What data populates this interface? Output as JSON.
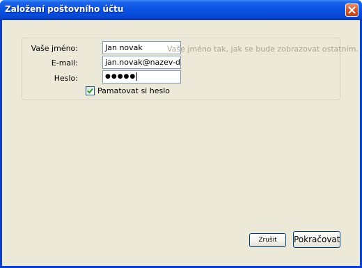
{
  "window": {
    "title": "Založení poštovního účtu"
  },
  "form": {
    "name": {
      "label": "Vaše jméno:",
      "value": "Jan novak",
      "hint": "Vaše jméno tak, jak se bude zobrazovat ostatním."
    },
    "email": {
      "label": "E-mail:",
      "value": "jan.novak@nazev-dome"
    },
    "password": {
      "label": "Heslo:",
      "value": "●●●●●"
    },
    "remember": {
      "label": "Pamatovat si heslo",
      "checked": true
    }
  },
  "buttons": {
    "cancel": "Zrušit",
    "continue": "Pokračovat"
  },
  "colors": {
    "titlebar": "#0a54e3",
    "client_bg": "#ece9d8",
    "hint_text": "#a8a492",
    "close_button": "#d8582e"
  },
  "icons": {
    "close": "close-icon",
    "check": "check-icon"
  }
}
